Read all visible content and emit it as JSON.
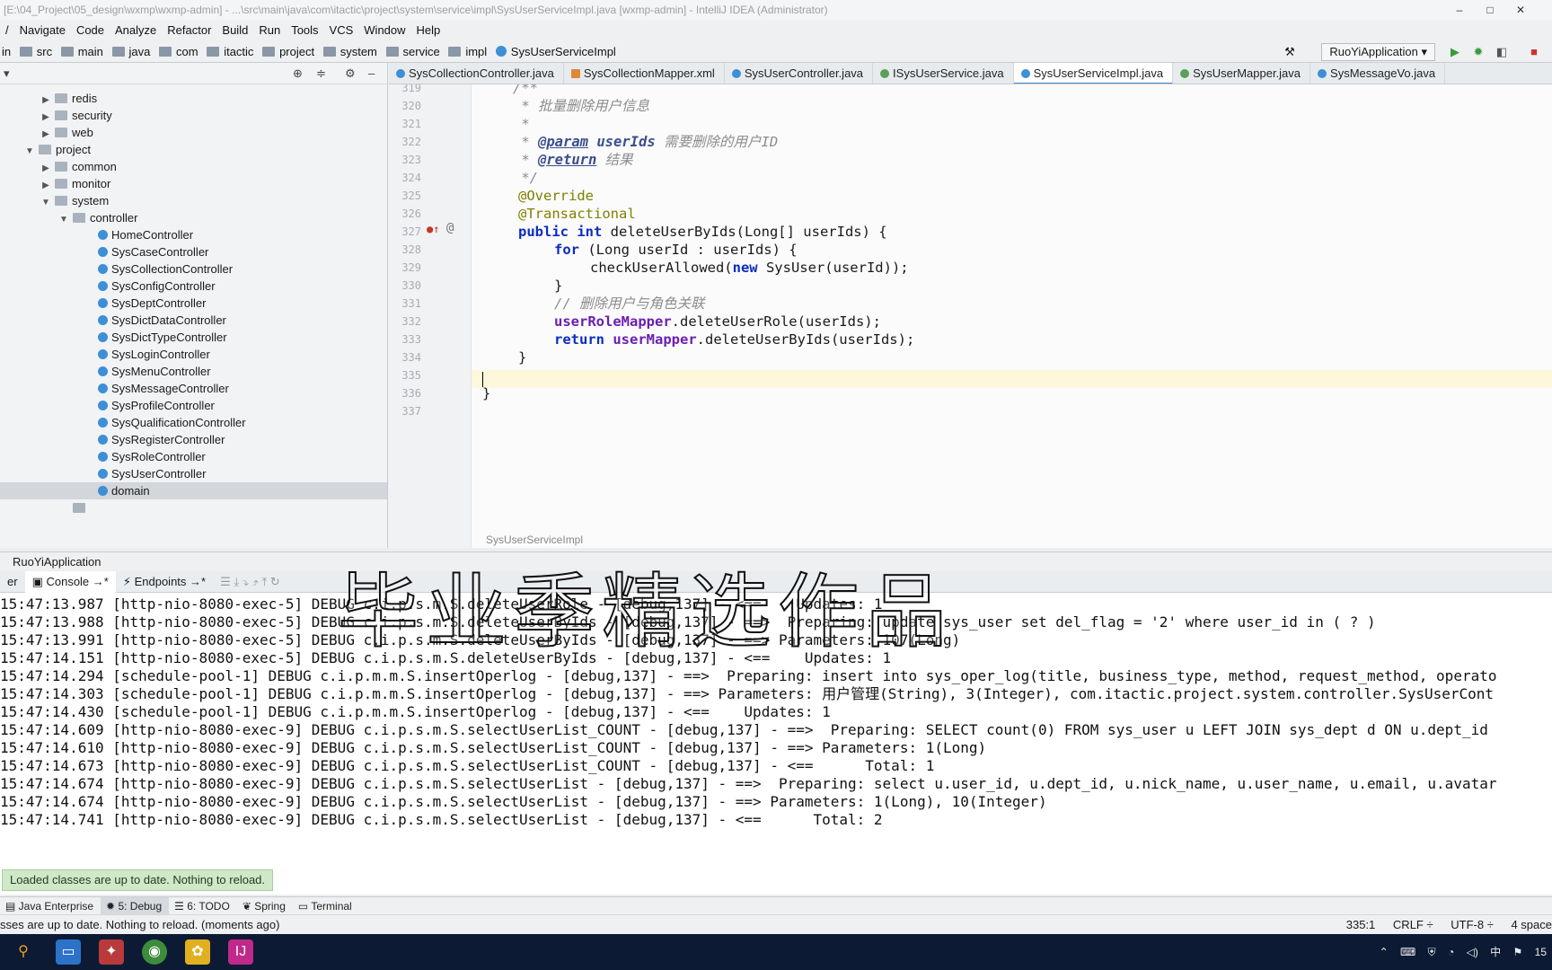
{
  "titlebar": {
    "text": "[E:\\04_Project\\05_design\\wxmp\\wxmp-admin] - ...\\src\\main\\java\\com\\itactic\\project\\system\\service\\impl\\SysUserServiceImpl.java [wxmp-admin] - IntelliJ IDEA (Administrator)"
  },
  "menu": [
    {
      "label": "Navigate"
    },
    {
      "label": "Code"
    },
    {
      "label": "Analyze"
    },
    {
      "label": "Refactor"
    },
    {
      "label": "Build"
    },
    {
      "label": "Run"
    },
    {
      "label": "Tools"
    },
    {
      "label": "VCS"
    },
    {
      "label": "Window"
    },
    {
      "label": "Help"
    }
  ],
  "nav": {
    "crumbs": [
      "in",
      "src",
      "main",
      "java",
      "com",
      "itactic",
      "project",
      "system",
      "service",
      "impl",
      "SysUserServiceImpl"
    ],
    "run_config": "RuoYiApplication"
  },
  "tree": {
    "rows": [
      {
        "label": "redis",
        "arrow": "▶"
      },
      {
        "label": "security",
        "arrow": "▶"
      },
      {
        "label": "web",
        "arrow": "▶"
      },
      {
        "label": "project",
        "arrow": "▼"
      },
      {
        "label": "common",
        "arrow": "▶"
      },
      {
        "label": "monitor",
        "arrow": "▶"
      },
      {
        "label": "system",
        "arrow": "▼"
      },
      {
        "label": "controller",
        "arrow": "▼"
      },
      {
        "label": "HomeController"
      },
      {
        "label": "SysCaseController"
      },
      {
        "label": "SysCollectionController"
      },
      {
        "label": "SysConfigController"
      },
      {
        "label": "SysDeptController"
      },
      {
        "label": "SysDictDataController"
      },
      {
        "label": "SysDictTypeController"
      },
      {
        "label": "SysLoginController"
      },
      {
        "label": "SysMenuController"
      },
      {
        "label": "SysMessageController"
      },
      {
        "label": "SysProfileController"
      },
      {
        "label": "SysQualificationController"
      },
      {
        "label": "SysRegisterController"
      },
      {
        "label": "SysRoleController"
      },
      {
        "label": "SysUserController"
      },
      {
        "label": "domain",
        "arrow": "▶"
      }
    ]
  },
  "tabs": [
    {
      "label": "SysCollectionController.java"
    },
    {
      "label": "SysCollectionMapper.xml"
    },
    {
      "label": "SysUserController.java"
    },
    {
      "label": "ISysUserService.java"
    },
    {
      "label": "SysUserServiceImpl.java"
    },
    {
      "label": "SysUserMapper.java"
    },
    {
      "label": "SysMessageVo.java"
    }
  ],
  "editor": {
    "line_numbers": [
      "319",
      "320",
      "321",
      "322",
      "323",
      "324",
      "325",
      "326",
      "327",
      "328",
      "329",
      "330",
      "331",
      "332",
      "333",
      "334",
      "335",
      "336",
      "337"
    ],
    "code": {
      "l319": "/**",
      "l320_star": " * ",
      "l320_text": "批量删除用户信息",
      "l321": " *",
      "l322_star": " * ",
      "l322_tag": "@param",
      "l322_param": " userIds",
      "l322_text": " 需要删除的用户ID",
      "l323_star": " * ",
      "l323_tag": "@return",
      "l323_text": " 结果",
      "l324": " */",
      "l325": "@Override",
      "l326": "@Transactional",
      "l327_kw": "public int",
      "l327_rest": " deleteUserByIds(Long[] userIds) {",
      "l328_kw": "for",
      "l328_rest": " (Long userId : userIds) {",
      "l329_pre": "checkUserAllowed(",
      "l329_kw": "new",
      "l329_rest": " SysUser(userId));",
      "l330": "}",
      "l331": "// 删除用户与角色关联",
      "l332_fld": "userRoleMapper",
      "l332_rest": ".deleteUserRole(userIds);",
      "l333_kw": "return",
      "l333_fld": " userMapper",
      "l333_rest": ".deleteUserByIds(userIds);",
      "l334": "}",
      "l336": "}"
    },
    "footer_breadcrumb": "SysUserServiceImpl",
    "gutter_at": "@"
  },
  "run_panel": {
    "title": "RuoYiApplication",
    "tabs": [
      "er",
      "Console",
      "Endpoints"
    ]
  },
  "console": [
    "15:47:13.987 [http-nio-8080-exec-5] DEBUG c.i.p.s.m.S.deleteUserRole - [debug,137] - <==    Updates: 1",
    "15:47:13.988 [http-nio-8080-exec-5] DEBUG c.i.p.s.m.S.deleteUserByIds - [debug,137] - ==>  Preparing: update sys_user set del_flag = '2' where user_id in ( ? )",
    "15:47:13.991 [http-nio-8080-exec-5] DEBUG c.i.p.s.m.S.deleteUserByIds - [debug,137] - ==> Parameters: 107(Long)",
    "15:47:14.151 [http-nio-8080-exec-5] DEBUG c.i.p.s.m.S.deleteUserByIds - [debug,137] - <==    Updates: 1",
    "15:47:14.294 [schedule-pool-1] DEBUG c.i.p.m.m.S.insertOperlog - [debug,137] - ==>  Preparing: insert into sys_oper_log(title, business_type, method, request_method, operato",
    "15:47:14.303 [schedule-pool-1] DEBUG c.i.p.m.m.S.insertOperlog - [debug,137] - ==> Parameters: 用户管理(String), 3(Integer), com.itactic.project.system.controller.SysUserCont",
    "15:47:14.430 [schedule-pool-1] DEBUG c.i.p.m.m.S.insertOperlog - [debug,137] - <==    Updates: 1",
    "15:47:14.609 [http-nio-8080-exec-9] DEBUG c.i.p.s.m.S.selectUserList_COUNT - [debug,137] - ==>  Preparing: SELECT count(0) FROM sys_user u LEFT JOIN sys_dept d ON u.dept_id",
    "15:47:14.610 [http-nio-8080-exec-9] DEBUG c.i.p.s.m.S.selectUserList_COUNT - [debug,137] - ==> Parameters: 1(Long)",
    "15:47:14.673 [http-nio-8080-exec-9] DEBUG c.i.p.s.m.S.selectUserList_COUNT - [debug,137] - <==      Total: 1",
    "15:47:14.674 [http-nio-8080-exec-9] DEBUG c.i.p.s.m.S.selectUserList - [debug,137] - ==>  Preparing: select u.user_id, u.dept_id, u.nick_name, u.user_name, u.email, u.avatar",
    "15:47:14.674 [http-nio-8080-exec-9] DEBUG c.i.p.s.m.S.selectUserList - [debug,137] - ==> Parameters: 1(Long), 10(Integer)",
    "15:47:14.741 [http-nio-8080-exec-9] DEBUG c.i.p.s.m.S.selectUserList - [debug,137] - <==      Total: 2"
  ],
  "watermark": "毕业季精选作品",
  "notification": "Loaded classes are up to date. Nothing to reload.",
  "toolwindows": [
    "Java Enterprise",
    "5: Debug",
    "6: TODO",
    "Spring",
    "Terminal"
  ],
  "status": {
    "message": "sses are up to date. Nothing to reload. (moments ago)",
    "position": "335:1",
    "line_sep": "CRLF ÷",
    "encoding": "UTF-8 ÷",
    "indent": "4 space"
  },
  "taskbar": {
    "tray_ime": "中",
    "tray_clock": "15"
  },
  "colors": {
    "keyword": "#0b2dbf",
    "annotation": "#808000",
    "comment": "#8c8c8c",
    "field": "#6b1fb0",
    "taskbar": "#0c1a33"
  }
}
